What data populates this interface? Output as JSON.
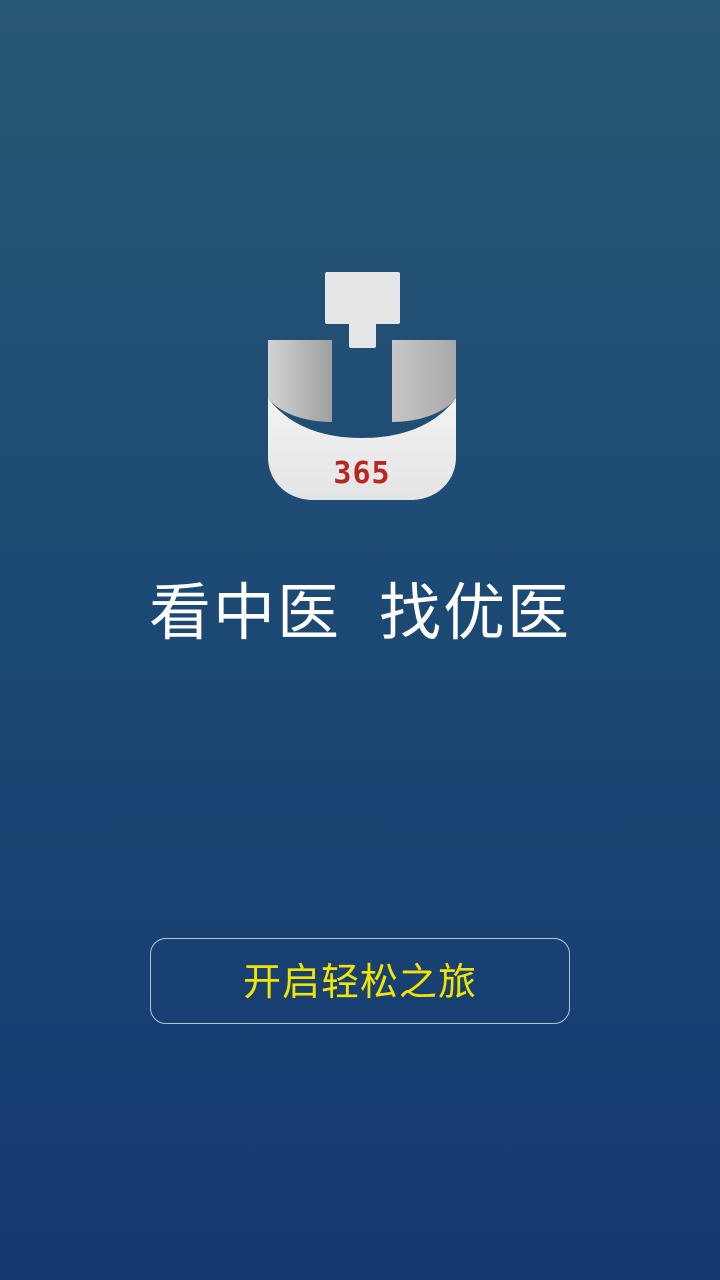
{
  "app": {
    "logo_badge_text": "365",
    "logo_icon": "medical-cross-u-icon"
  },
  "slogan": {
    "part1": "看中医",
    "part2": "找优医"
  },
  "start_button": {
    "label": "开启轻松之旅"
  },
  "colors": {
    "background_top": "#285773",
    "background_bottom": "#143870",
    "button_text": "#f3e400",
    "badge_red": "#b8261f"
  }
}
